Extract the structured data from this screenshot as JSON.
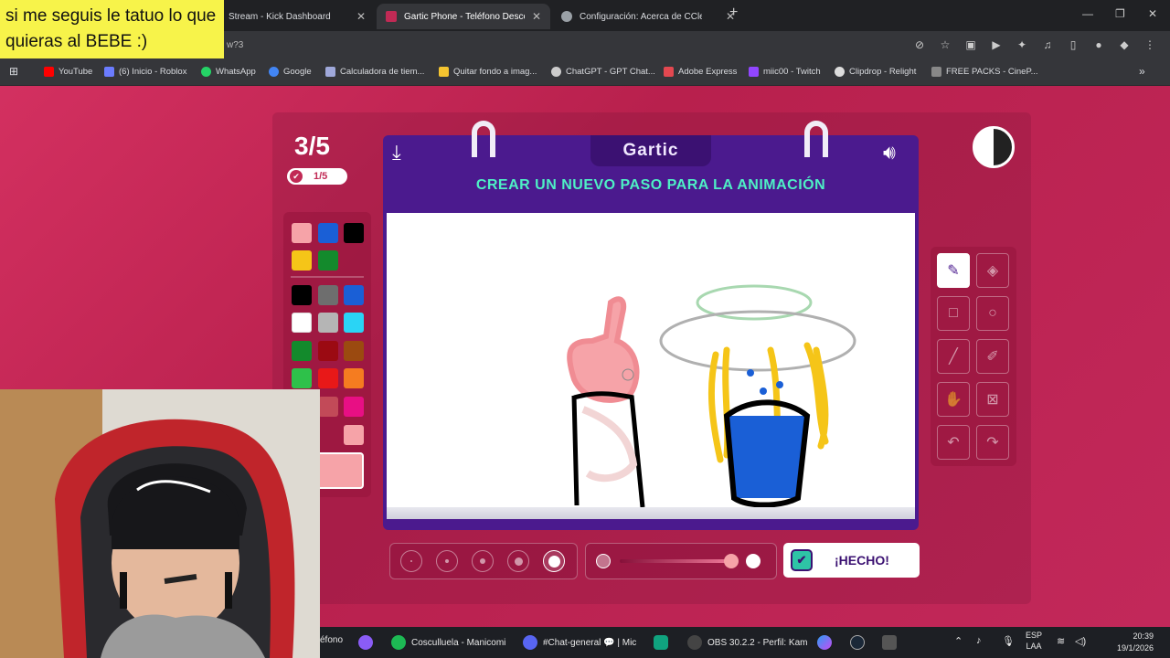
{
  "overlay_caption": "si me seguis le tatuo lo que quieras al BEBE :)",
  "browser": {
    "tabs": [
      {
        "title": "Stream - Kick Dashboard",
        "active": false
      },
      {
        "title": "Gartic Phone - Teléfono Descon",
        "active": true
      },
      {
        "title": "Configuración: Acerca de CClea",
        "active": false
      }
    ],
    "url": "w?3",
    "bookmarks": [
      {
        "label": "YouTube",
        "color": "#ff0000"
      },
      {
        "label": "(6) Inicio - Roblox",
        "color": "#6b7cff"
      },
      {
        "label": "WhatsApp",
        "color": "#25d366"
      },
      {
        "label": "Google",
        "color": "#4285f4"
      },
      {
        "label": "Calculadora de tiem...",
        "color": "#9fa8da"
      },
      {
        "label": "Quitar fondo a imag...",
        "color": "#f4c430"
      },
      {
        "label": "ChatGPT - GPT Chat...",
        "color": "#cccccc"
      },
      {
        "label": "Adobe Express",
        "color": "#e34850"
      },
      {
        "label": "miic00 - Twitch",
        "color": "#9146ff"
      },
      {
        "label": "Clipdrop - Relight",
        "color": "#dddddd"
      },
      {
        "label": "FREE PACKS - CineP...",
        "color": "#888888"
      }
    ]
  },
  "game": {
    "round": "3/5",
    "progress": "1/5",
    "logo": "Gartic",
    "instruction": "CREAR UN NUEVO PASO PARA LA ANIMACIÓN",
    "done_label": "¡HECHO!",
    "palette_colors": [
      "#f6a3a8",
      "#1a5fd6",
      "#000000",
      "#f5c518",
      "#138a2c",
      "#000000",
      "#6e6e6e",
      "#1a5fd6",
      "#ffffff",
      "#b5b5b5",
      "#2ad4f5",
      "#138a2c",
      "#9b0a12",
      "#9b4a10",
      "#2ec14a",
      "#e81818",
      "#f57c20",
      "#8c1b48",
      "#c24a58",
      "#e80f84",
      "#f6a3a8"
    ],
    "selected_color": "#f6a3a8",
    "brush_sizes_count": 5,
    "active_brush_size": 5,
    "tools": [
      "pencil-icon",
      "eraser-icon",
      "rectangle-icon",
      "ellipse-icon",
      "line-icon",
      "eyedropper-icon",
      "fill-icon",
      "layer-off-icon",
      "undo-icon",
      "redo-icon"
    ],
    "active_tool": "pencil-icon"
  },
  "taskbar": {
    "items": [
      {
        "label": "éfono",
        "color": "#ff8c00"
      },
      {
        "label": "",
        "color": "#8a5cf6"
      },
      {
        "label": "Cosculluela - Manicomi",
        "color": "#1db954"
      },
      {
        "label": "#Chat-general 💬 | Mic",
        "color": "#5865f2"
      },
      {
        "label": "",
        "color": "#10a37f"
      },
      {
        "label": "OBS 30.2.2 - Perfil: Kam",
        "color": "#444444"
      }
    ],
    "lang_top": "ESP",
    "lang_bottom": "LAA",
    "time": "20:39",
    "date": "19/1/2026"
  }
}
